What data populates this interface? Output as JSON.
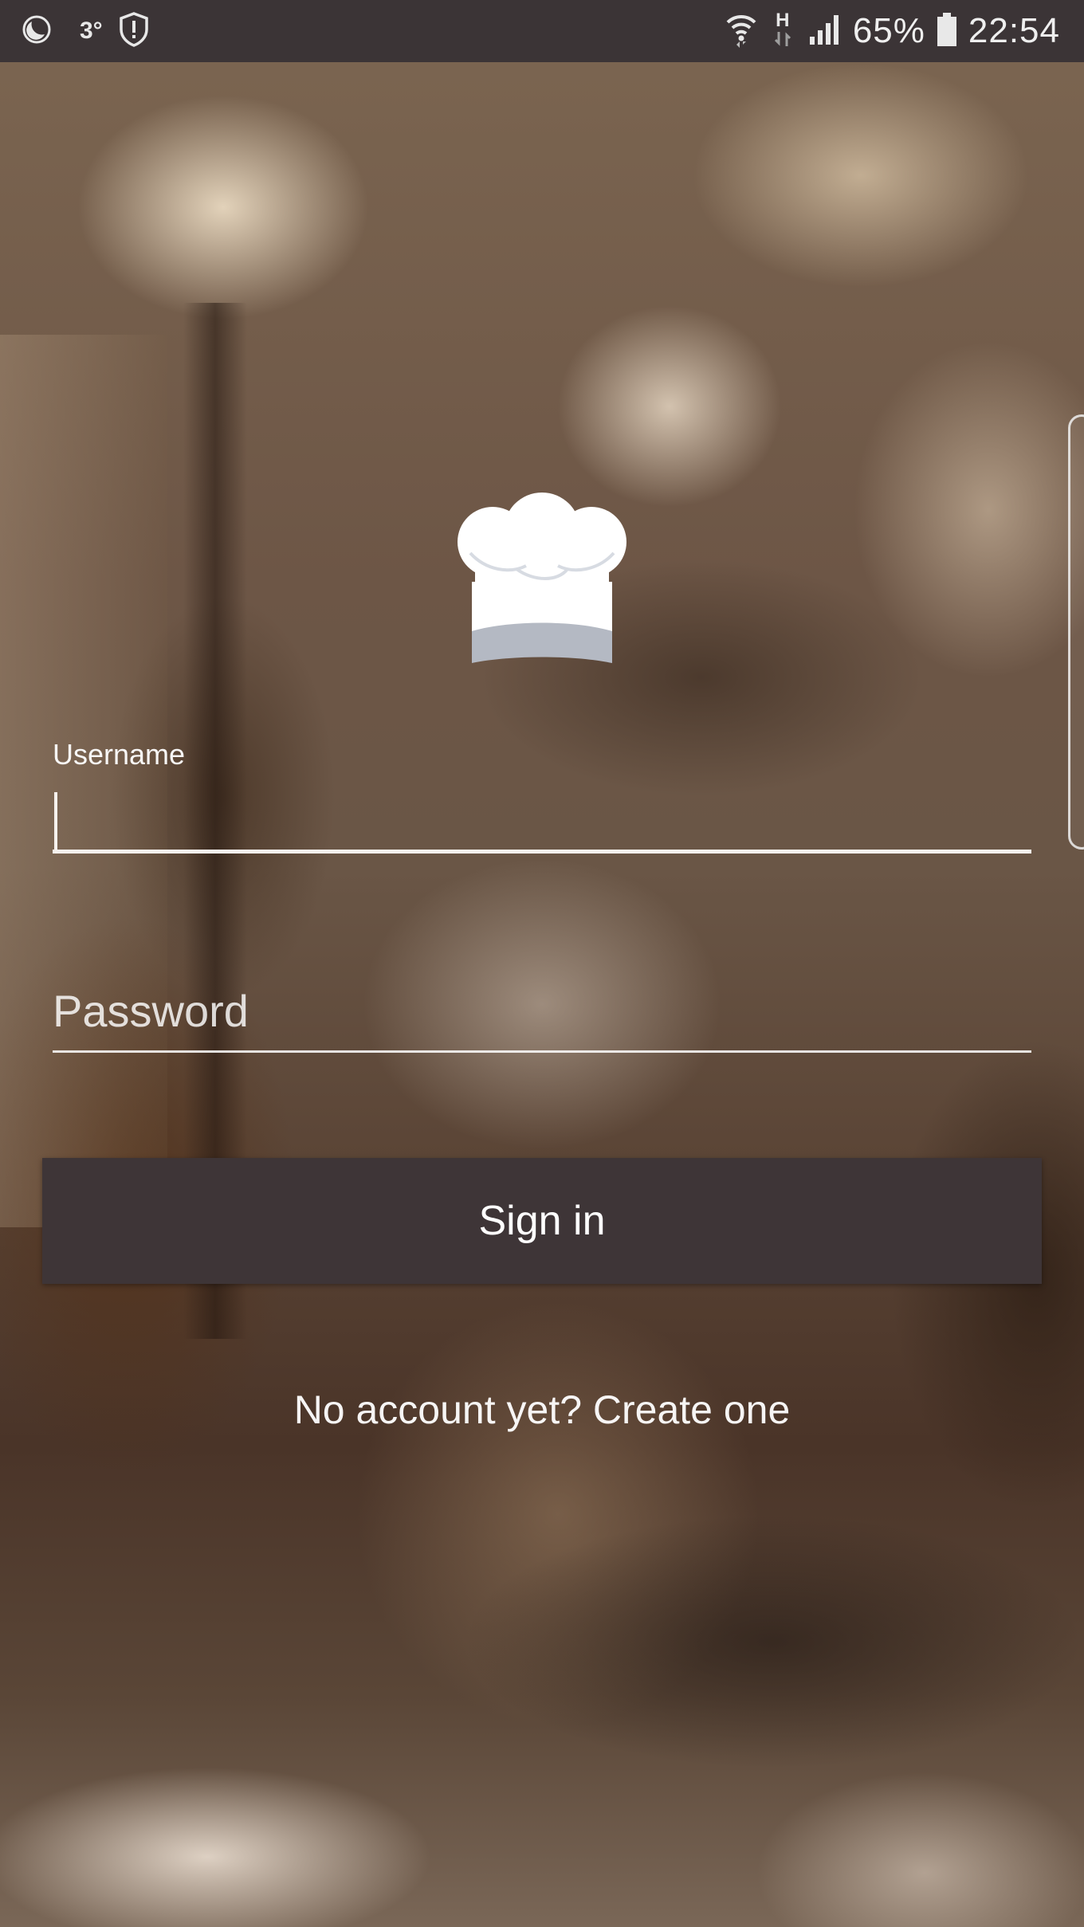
{
  "status_bar": {
    "weather_temp": "3°",
    "network_type": "H",
    "battery_percent": "65%",
    "time": "22:54",
    "icons": [
      "moon-icon",
      "shield-alert-icon",
      "wifi-icon",
      "network-h-icon",
      "signal-icon",
      "battery-icon"
    ]
  },
  "logo": {
    "icon": "chef-hat-icon"
  },
  "form": {
    "username_label": "Username",
    "username_value": "",
    "password_placeholder": "Password",
    "password_value": "",
    "signin_label": "Sign in"
  },
  "footer": {
    "create_account_text": "No account yet? Create one"
  },
  "colors": {
    "status_bar_bg": "#3b3436",
    "button_bg": "#3e3537",
    "text": "#ffffff",
    "hat_band": "#b4b9c3"
  }
}
